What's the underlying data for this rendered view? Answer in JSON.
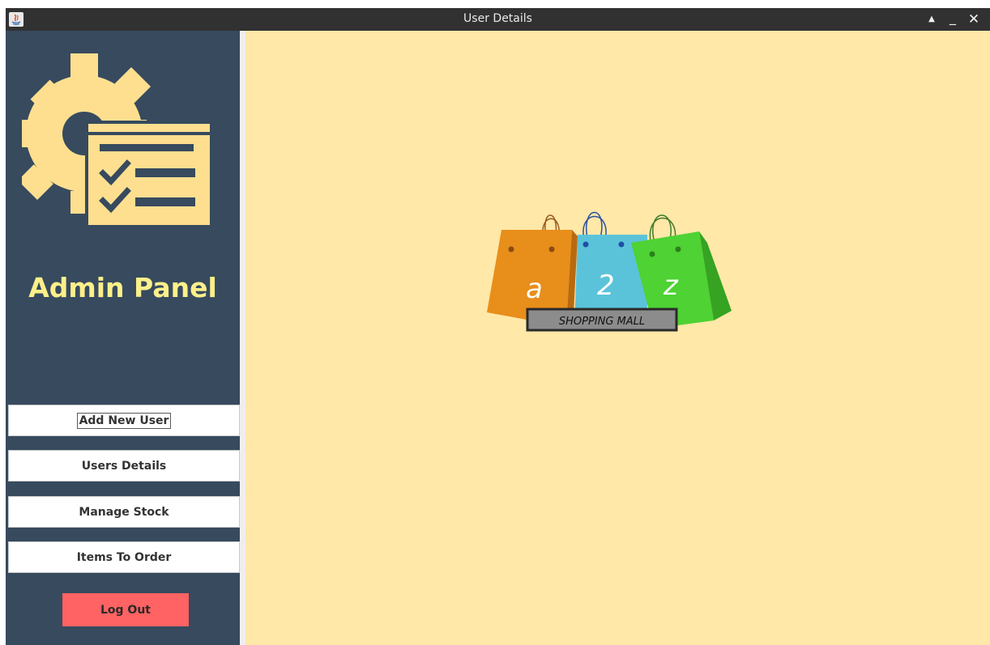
{
  "window": {
    "title": "User Details",
    "controls": {
      "maximize": "▲",
      "minimize": "_",
      "close": "✕"
    }
  },
  "sidebar": {
    "heading": "Admin Panel",
    "buttons": [
      {
        "label": "Add New User",
        "focused": true
      },
      {
        "label": "Users Details",
        "focused": false
      },
      {
        "label": "Manage Stock",
        "focused": false
      },
      {
        "label": "Items To Order",
        "focused": false
      }
    ],
    "logout_label": "Log Out"
  },
  "main": {
    "logo": {
      "letters": [
        "a",
        "2",
        "z"
      ],
      "tagline": "SHOPPING MALL"
    }
  },
  "colors": {
    "titlebar": "#313131",
    "sidebar": "#374a5e",
    "main_background": "#ffe8a8",
    "heading": "#fdf08a",
    "logout": "#ff6363",
    "icon": "#fddf8f"
  }
}
